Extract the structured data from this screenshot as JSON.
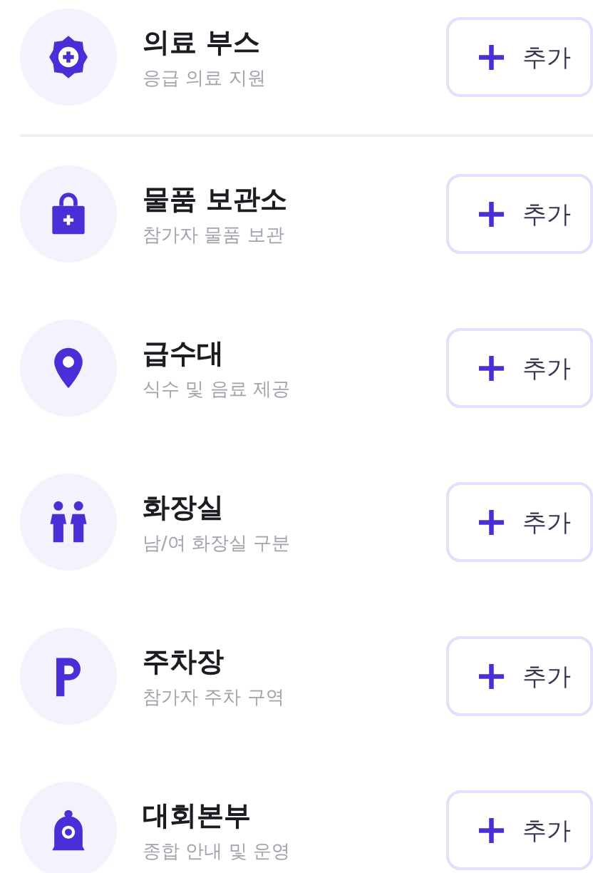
{
  "groups": [
    {
      "facilities": [
        {
          "kind": "medical",
          "title": "의료 부스",
          "subtitle": "응급 의료 지원",
          "button": {
            "icon": "+",
            "label": "추가"
          }
        }
      ]
    },
    {
      "facilities": [
        {
          "kind": "storage",
          "title": "물품 보관소",
          "subtitle": "참가자 물품 보관",
          "button": {
            "icon": "+",
            "label": "추가"
          }
        },
        {
          "kind": "water",
          "title": "급수대",
          "subtitle": "식수 및 음료 제공",
          "button": {
            "icon": "+",
            "label": "추가"
          }
        },
        {
          "kind": "restroom",
          "title": "화장실",
          "subtitle": "남/여 화장실 구분",
          "button": {
            "icon": "+",
            "label": "추가"
          }
        },
        {
          "kind": "parking",
          "title": "주차장",
          "subtitle": "참가자 주차 구역",
          "button": {
            "icon": "+",
            "label": "추가"
          }
        },
        {
          "kind": "hq",
          "title": "대회본부",
          "subtitle": "종합 안내 및 운영",
          "button": {
            "icon": "+",
            "label": "추가"
          }
        }
      ]
    }
  ]
}
